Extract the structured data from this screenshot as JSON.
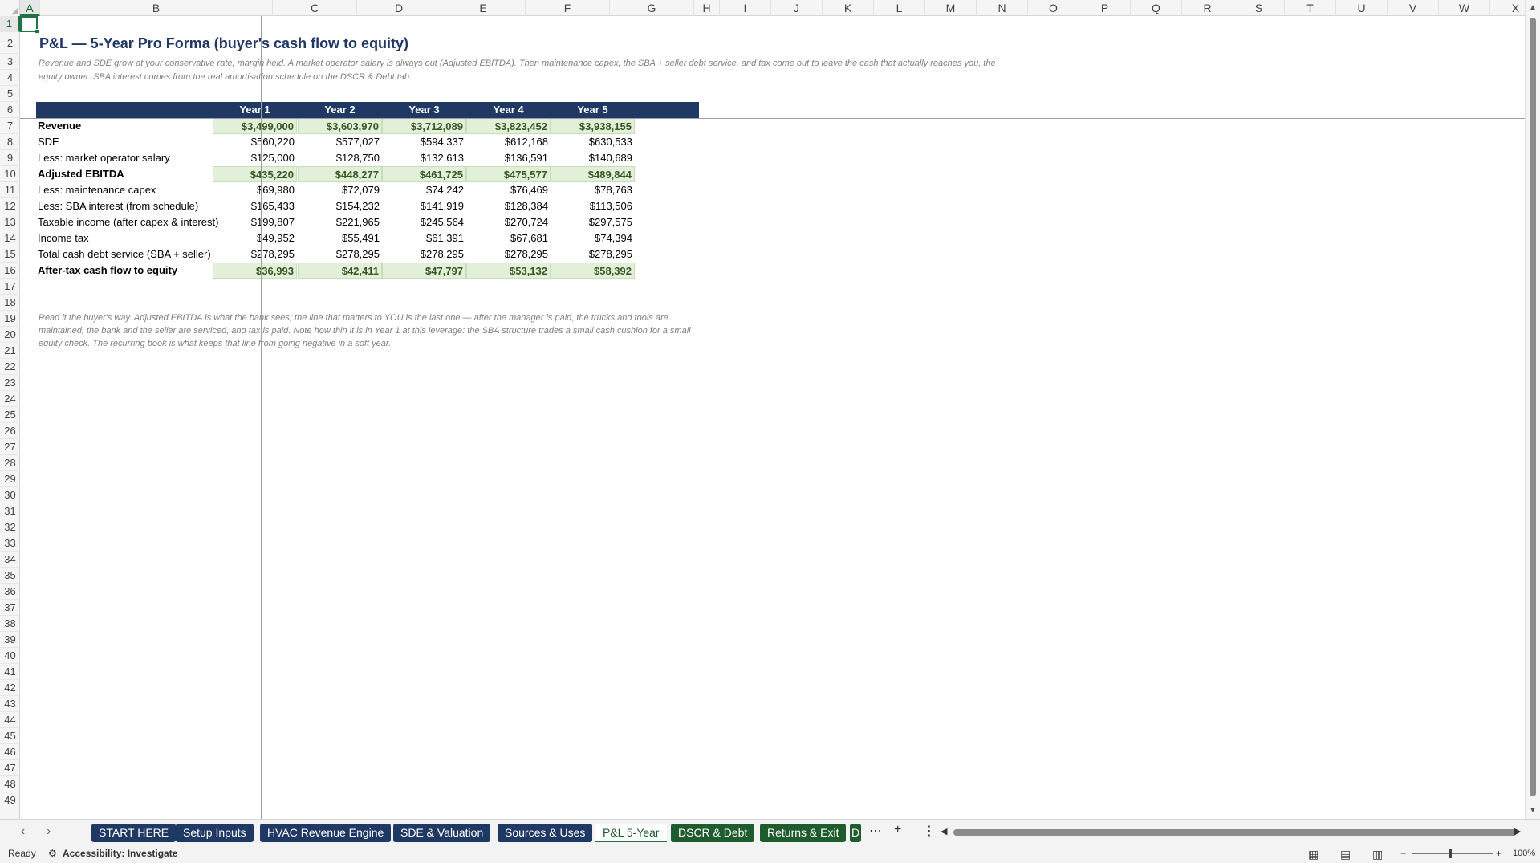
{
  "columns": [
    "A",
    "B",
    "C",
    "D",
    "E",
    "F",
    "G",
    "H",
    "I",
    "J",
    "K",
    "L",
    "M",
    "N",
    "O",
    "P",
    "Q",
    "R",
    "S",
    "T",
    "U",
    "V",
    "W",
    "X"
  ],
  "rows": [
    "1",
    "2",
    "3",
    "4",
    "5",
    "6",
    "7",
    "8",
    "9",
    "10",
    "11",
    "12",
    "13",
    "14",
    "15",
    "16",
    "17",
    "18",
    "19",
    "20",
    "21",
    "22",
    "23",
    "24",
    "25",
    "26",
    "27",
    "28",
    "29",
    "30",
    "31",
    "32",
    "33",
    "34",
    "35",
    "36",
    "37",
    "38",
    "39",
    "40",
    "41",
    "42",
    "43",
    "44",
    "45",
    "46",
    "47",
    "48",
    "49"
  ],
  "sheet": {
    "title": "P&L — 5-Year Pro Forma (buyer's cash flow to equity)",
    "subtitle": "Revenue and SDE grow at your conservative rate, margin held. A market operator salary is always out (Adjusted EBITDA). Then maintenance capex, the SBA + seller debt service, and tax come out to leave the cash that actually reaches you, the equity owner. SBA interest comes from the real amortisation schedule on the DSCR & Debt tab.",
    "headers": [
      "Year 1",
      "Year 2",
      "Year 3",
      "Year 4",
      "Year 5"
    ],
    "table": [
      {
        "label": "Revenue",
        "bold": true,
        "highlight": true,
        "values": [
          "$3,499,000",
          "$3,603,970",
          "$3,712,089",
          "$3,823,452",
          "$3,938,155"
        ]
      },
      {
        "label": "SDE",
        "bold": false,
        "highlight": false,
        "values": [
          "$560,220",
          "$577,027",
          "$594,337",
          "$612,168",
          "$630,533"
        ]
      },
      {
        "label": "Less: market operator salary",
        "bold": false,
        "highlight": false,
        "values": [
          "$125,000",
          "$128,750",
          "$132,613",
          "$136,591",
          "$140,689"
        ]
      },
      {
        "label": "Adjusted EBITDA",
        "bold": true,
        "highlight": true,
        "values": [
          "$435,220",
          "$448,277",
          "$461,725",
          "$475,577",
          "$489,844"
        ]
      },
      {
        "label": "Less: maintenance capex",
        "bold": false,
        "highlight": false,
        "values": [
          "$69,980",
          "$72,079",
          "$74,242",
          "$76,469",
          "$78,763"
        ]
      },
      {
        "label": "Less: SBA interest (from schedule)",
        "bold": false,
        "highlight": false,
        "values": [
          "$165,433",
          "$154,232",
          "$141,919",
          "$128,384",
          "$113,506"
        ]
      },
      {
        "label": "Taxable income (after capex & interest)",
        "bold": false,
        "highlight": false,
        "values": [
          "$199,807",
          "$221,965",
          "$245,564",
          "$270,724",
          "$297,575"
        ]
      },
      {
        "label": "Income tax",
        "bold": false,
        "highlight": false,
        "values": [
          "$49,952",
          "$55,491",
          "$61,391",
          "$67,681",
          "$74,394"
        ]
      },
      {
        "label": "Total cash debt service (SBA + seller)",
        "bold": false,
        "highlight": false,
        "values": [
          "$278,295",
          "$278,295",
          "$278,295",
          "$278,295",
          "$278,295"
        ]
      },
      {
        "label": "After-tax cash flow to equity",
        "bold": true,
        "highlight": true,
        "values": [
          "$36,993",
          "$42,411",
          "$47,797",
          "$53,132",
          "$58,392"
        ]
      }
    ],
    "note": "Read it the buyer's way. Adjusted EBITDA is what the bank sees; the line that matters to YOU is the last one — after the manager is paid, the trucks and tools are maintained, the bank and the seller are serviced, and tax is paid. Note how thin it is in Year 1 at this leverage: the SBA structure trades a small cash cushion for a small equity check. The recurring book is what keeps that line from going negative in a soft year."
  },
  "tabs": [
    {
      "label": "START HERE",
      "style": "blue"
    },
    {
      "label": "Setup Inputs",
      "style": "blue"
    },
    {
      "label": "HVAC Revenue Engine",
      "style": "blue"
    },
    {
      "label": "SDE & Valuation",
      "style": "blue"
    },
    {
      "label": "Sources & Uses",
      "style": "blue"
    },
    {
      "label": "P&L 5-Year",
      "style": "active"
    },
    {
      "label": "DSCR & Debt",
      "style": "green"
    },
    {
      "label": "Returns & Exit",
      "style": "green"
    },
    {
      "label": "D",
      "style": "green"
    }
  ],
  "status": {
    "ready": "Ready",
    "accessibility": "Accessibility: Investigate",
    "zoom": "100%"
  },
  "colors": {
    "header_navy": "#1f3864",
    "highlight_green": "#e2efd9",
    "excel_green": "#217346"
  }
}
